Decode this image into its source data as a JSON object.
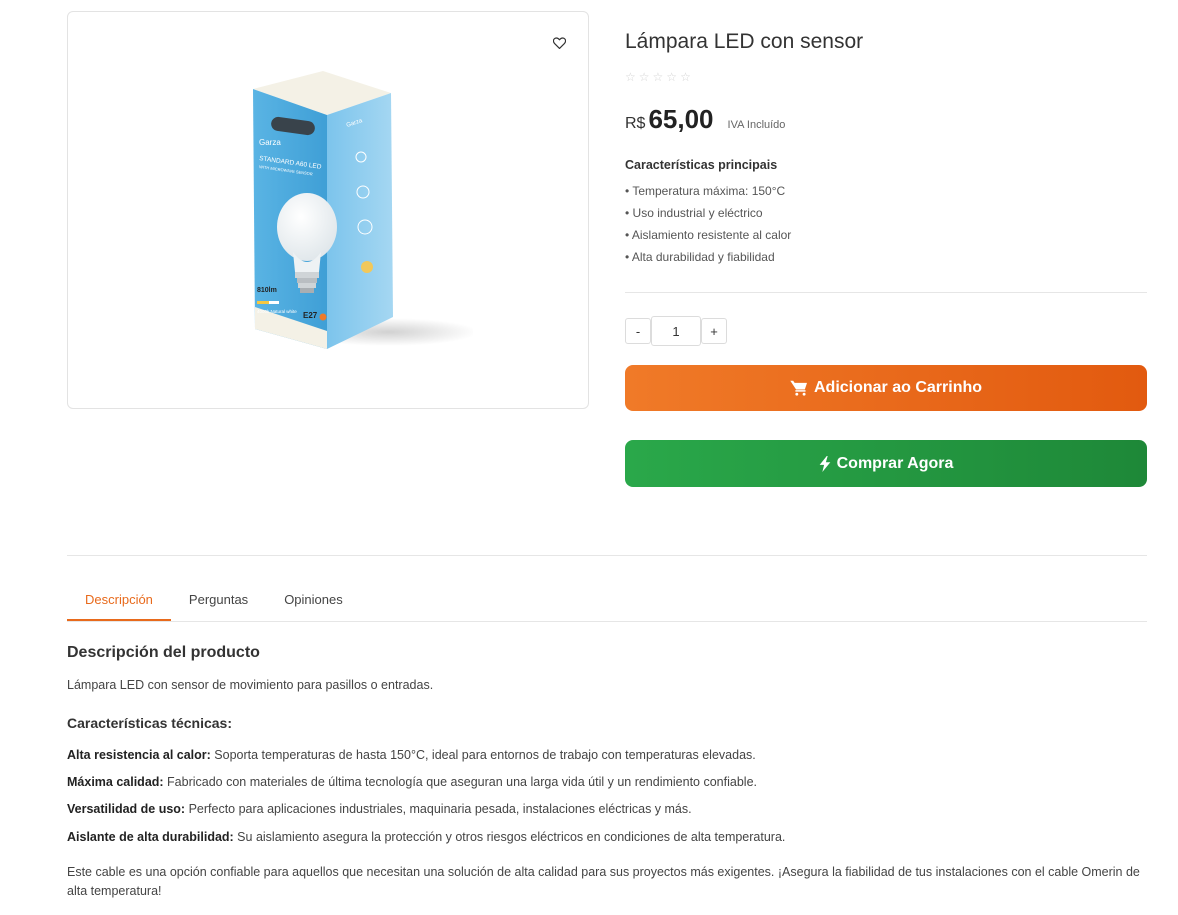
{
  "product": {
    "title": "Lámpara LED con sensor",
    "rating_stars": 5,
    "currency": "R$",
    "price": "65,00",
    "tax_note": "IVA Incluído",
    "box_brand": "Garza",
    "box_title": "STANDARD A60 LED",
    "box_subtitle": "WITH MICROWAVE SENSOR",
    "box_lumens": "810lm",
    "box_socket": "E27",
    "box_color": "4000k Natural white"
  },
  "features": {
    "title": "Características principais",
    "items": [
      "• Temperatura máxima: 150°C",
      "• Uso industrial y eléctrico",
      "• Aislamiento resistente al calor",
      "• Alta durabilidad y fiabilidad"
    ]
  },
  "quantity": {
    "minus": "-",
    "value": "1",
    "plus": "+"
  },
  "buttons": {
    "add_to_cart": "Adicionar ao Carrinho",
    "buy_now": "Comprar Agora"
  },
  "tabs": [
    "Descripción",
    "Perguntas",
    "Opiniones"
  ],
  "description": {
    "title": "Descripción del producto",
    "text": "Lámpara LED con sensor de movimiento para pasillos o entradas.",
    "tech_title": "Características técnicas:",
    "tech_items": [
      {
        "label": "Alta resistencia al calor:",
        "text": " Soporta temperaturas de hasta 150°C, ideal para entornos de trabajo con temperaturas elevadas."
      },
      {
        "label": "Máxima calidad:",
        "text": " Fabricado con materiales de última tecnología que aseguran una larga vida útil y un rendimiento confiable."
      },
      {
        "label": "Versatilidad de uso:",
        "text": " Perfecto para aplicaciones industriales, maquinaria pesada, instalaciones eléctricas y más."
      },
      {
        "label": "Aislante de alta durabilidad:",
        "text": " Su aislamiento asegura la protección y otros riesgos eléctricos en condiciones de alta temperatura."
      }
    ],
    "closing": "Este cable es una opción confiable para aquellos que necesitan una solución de alta calidad para sus proyectos más exigentes. ¡Asegura la fiabilidad de tus instalaciones con el cable Omerin de alta temperatura!"
  },
  "colors": {
    "accent": "#e86a1c",
    "cart_button": "#ee7424",
    "buy_button": "#25a045",
    "box_blue": "#4aa9dc"
  },
  "icons": {
    "wishlist": "heart-icon",
    "cart": "cart-icon",
    "buy": "lightning-icon",
    "rating": "star-icon"
  }
}
